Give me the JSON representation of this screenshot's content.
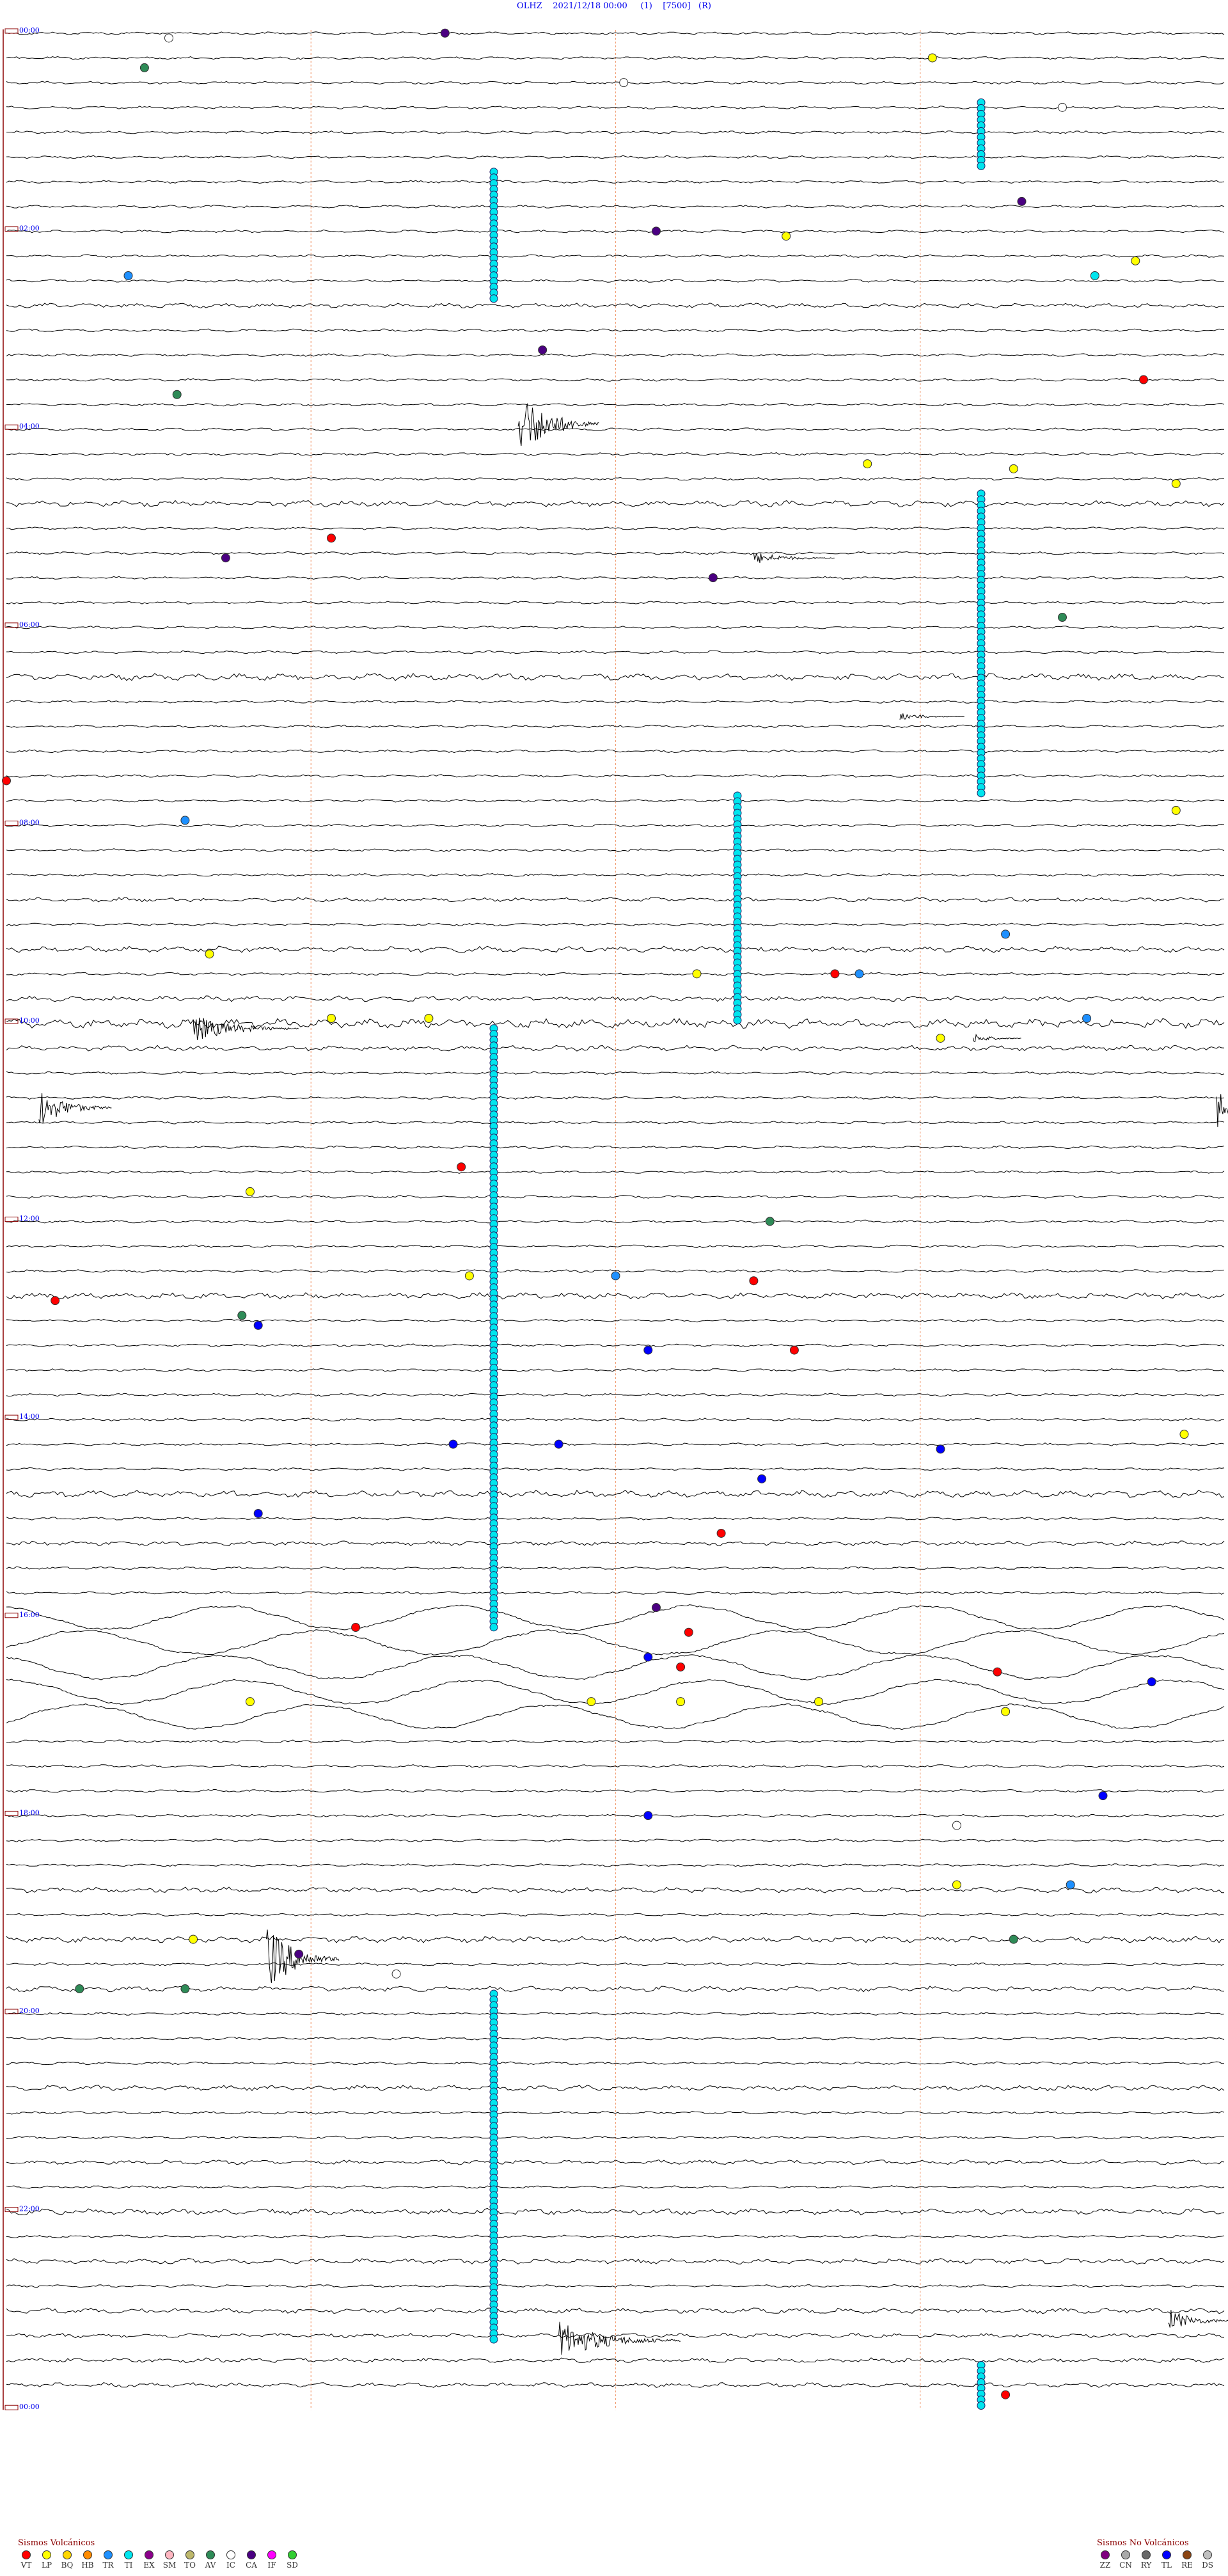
{
  "header": {
    "station": "OLHZ",
    "datetime": "2021/12/18 00:00",
    "count": "(1)",
    "scale": "[7500]",
    "flag": "(R)"
  },
  "colors": {
    "trace": "#000000",
    "time_label": "#0000ee",
    "minute_guides": "#f2a27a",
    "frame": "#8b0000"
  },
  "chart_data": {
    "type": "helicorder",
    "hour_labels": [
      "00:00",
      "02:00",
      "04:00",
      "06:00",
      "08:00",
      "10:00",
      "12:00",
      "14:00",
      "16:00",
      "18:00",
      "20:00",
      "22:00",
      "00:00"
    ],
    "lines_per_hour": 4,
    "minutes_per_line": 15,
    "total_hours": 24,
    "events": [
      {
        "hour": 0.05,
        "minute": 5.4,
        "type": "CA"
      },
      {
        "hour": 0.1,
        "minute": 2.0,
        "type": "IC"
      },
      {
        "hour": 0.3,
        "minute": 11.4,
        "type": "LP"
      },
      {
        "hour": 0.4,
        "minute": 1.7,
        "type": "AV"
      },
      {
        "hour": 0.55,
        "minute": 7.6,
        "type": "IC"
      },
      {
        "hour": 0.8,
        "minute": 13.0,
        "type": "IC"
      },
      {
        "hour": 1.75,
        "minute": 12.5,
        "type": "CA"
      },
      {
        "hour": 2.05,
        "minute": 8.0,
        "type": "CA"
      },
      {
        "hour": 2.1,
        "minute": 9.6,
        "type": "LP"
      },
      {
        "hour": 2.35,
        "minute": 13.9,
        "type": "LP"
      },
      {
        "hour": 2.5,
        "minute": 1.5,
        "type": "TR"
      },
      {
        "hour": 2.5,
        "minute": 13.4,
        "type": "TI"
      },
      {
        "hour": 3.25,
        "minute": 6.6,
        "type": "CA"
      },
      {
        "hour": 3.55,
        "minute": 14.0,
        "type": "VT"
      },
      {
        "hour": 3.7,
        "minute": 2.1,
        "type": "AV"
      },
      {
        "hour": 4.4,
        "minute": 10.6,
        "type": "LP"
      },
      {
        "hour": 4.45,
        "minute": 12.4,
        "type": "LP"
      },
      {
        "hour": 4.6,
        "minute": 14.4,
        "type": "LP"
      },
      {
        "hour": 5.15,
        "minute": 4.0,
        "type": "VT"
      },
      {
        "hour": 5.35,
        "minute": 2.7,
        "type": "CA"
      },
      {
        "hour": 5.55,
        "minute": 8.7,
        "type": "CA"
      },
      {
        "hour": 5.95,
        "minute": 13.0,
        "type": "AV"
      },
      {
        "hour": 7.6,
        "minute": 0.0,
        "type": "VT"
      },
      {
        "hour": 7.9,
        "minute": 14.4,
        "type": "LP"
      },
      {
        "hour": 8.0,
        "minute": 2.2,
        "type": "TR"
      },
      {
        "hour": 9.15,
        "minute": 12.3,
        "type": "TR"
      },
      {
        "hour": 9.35,
        "minute": 2.5,
        "type": "LP"
      },
      {
        "hour": 9.55,
        "minute": 8.5,
        "type": "LP"
      },
      {
        "hour": 9.55,
        "minute": 10.2,
        "type": "VT"
      },
      {
        "hour": 9.55,
        "minute": 10.5,
        "type": "TR"
      },
      {
        "hour": 10.0,
        "minute": 4.0,
        "type": "LP"
      },
      {
        "hour": 10.0,
        "minute": 5.2,
        "type": "LP"
      },
      {
        "hour": 10.0,
        "minute": 13.3,
        "type": "TR"
      },
      {
        "hour": 10.2,
        "minute": 11.5,
        "type": "LP"
      },
      {
        "hour": 11.5,
        "minute": 5.6,
        "type": "VT"
      },
      {
        "hour": 11.75,
        "minute": 3.0,
        "type": "LP"
      },
      {
        "hour": 12.05,
        "minute": 9.4,
        "type": "AV"
      },
      {
        "hour": 12.6,
        "minute": 5.7,
        "type": "LP"
      },
      {
        "hour": 12.6,
        "minute": 7.5,
        "type": "TR"
      },
      {
        "hour": 12.65,
        "minute": 9.2,
        "type": "VT"
      },
      {
        "hour": 12.85,
        "minute": 0.6,
        "type": "VT"
      },
      {
        "hour": 13.0,
        "minute": 2.9,
        "type": "AV"
      },
      {
        "hour": 13.1,
        "minute": 3.1,
        "type": "TL"
      },
      {
        "hour": 13.35,
        "minute": 7.9,
        "type": "TL"
      },
      {
        "hour": 13.35,
        "minute": 9.7,
        "type": "VT"
      },
      {
        "hour": 14.2,
        "minute": 14.5,
        "type": "LP"
      },
      {
        "hour": 14.3,
        "minute": 5.5,
        "type": "TL"
      },
      {
        "hour": 14.3,
        "minute": 6.8,
        "type": "TL"
      },
      {
        "hour": 14.35,
        "minute": 11.5,
        "type": "TL"
      },
      {
        "hour": 14.65,
        "minute": 9.3,
        "type": "TL"
      },
      {
        "hour": 15.0,
        "minute": 3.1,
        "type": "TL"
      },
      {
        "hour": 15.2,
        "minute": 8.8,
        "type": "VT"
      },
      {
        "hour": 15.95,
        "minute": 8.0,
        "type": "CA"
      },
      {
        "hour": 16.15,
        "minute": 4.3,
        "type": "VT"
      },
      {
        "hour": 16.2,
        "minute": 8.4,
        "type": "VT"
      },
      {
        "hour": 16.45,
        "minute": 7.9,
        "type": "TL"
      },
      {
        "hour": 16.55,
        "minute": 8.3,
        "type": "VT"
      },
      {
        "hour": 16.6,
        "minute": 12.2,
        "type": "VT"
      },
      {
        "hour": 16.7,
        "minute": 14.1,
        "type": "TL"
      },
      {
        "hour": 16.9,
        "minute": 3.0,
        "type": "LP"
      },
      {
        "hour": 16.9,
        "minute": 7.2,
        "type": "LP"
      },
      {
        "hour": 16.9,
        "minute": 8.3,
        "type": "LP"
      },
      {
        "hour": 16.9,
        "minute": 10.0,
        "type": "LP"
      },
      {
        "hour": 17.0,
        "minute": 12.3,
        "type": "LP"
      },
      {
        "hour": 17.85,
        "minute": 13.5,
        "type": "TL"
      },
      {
        "hour": 18.05,
        "minute": 7.9,
        "type": "TL"
      },
      {
        "hour": 18.15,
        "minute": 11.7,
        "type": "IC"
      },
      {
        "hour": 18.75,
        "minute": 11.7,
        "type": "LP"
      },
      {
        "hour": 18.75,
        "minute": 13.1,
        "type": "TR"
      },
      {
        "hour": 19.3,
        "minute": 2.3,
        "type": "LP"
      },
      {
        "hour": 19.3,
        "minute": 12.4,
        "type": "AV"
      },
      {
        "hour": 19.45,
        "minute": 3.6,
        "type": "CA"
      },
      {
        "hour": 19.65,
        "minute": 4.8,
        "type": "IC"
      },
      {
        "hour": 19.8,
        "minute": 0.9,
        "type": "AV"
      },
      {
        "hour": 19.8,
        "minute": 2.2,
        "type": "AV"
      },
      {
        "hour": 23.9,
        "minute": 12.3,
        "type": "VT"
      }
    ],
    "swarm_columns": [
      {
        "hour_start": 0.7,
        "hour_end": 1.35,
        "minute": 12.0
      },
      {
        "hour_start": 1.4,
        "hour_end": 2.7,
        "minute": 6.0
      },
      {
        "hour_start": 4.65,
        "hour_end": 7.7,
        "minute": 12.0
      },
      {
        "hour_start": 7.7,
        "hour_end": 10.0,
        "minute": 9.0
      },
      {
        "hour_start": 10.05,
        "hour_end": 16.1,
        "minute": 6.0
      },
      {
        "hour_start": 19.8,
        "hour_end": 23.3,
        "minute": 6.0
      },
      {
        "hour_start": 23.55,
        "hour_end": 24.0,
        "minute": 12.0
      }
    ],
    "bursts": [
      {
        "hour": 3.95,
        "minute": 6.3,
        "amp": 55,
        "dur": 1.0
      },
      {
        "hour": 5.3,
        "minute": 9.2,
        "amp": 10,
        "dur": 1.0
      },
      {
        "hour": 6.9,
        "minute": 11.0,
        "amp": 6,
        "dur": 0.8
      },
      {
        "hour": 10.05,
        "minute": 2.3,
        "amp": 22,
        "dur": 1.3
      },
      {
        "hour": 10.15,
        "minute": 11.9,
        "amp": 8,
        "dur": 0.6
      },
      {
        "hour": 10.85,
        "minute": 0.4,
        "amp": 30,
        "dur": 0.9
      },
      {
        "hour": 10.85,
        "minute": 14.9,
        "amp": 35,
        "dur": 0.3
      },
      {
        "hour": 19.45,
        "minute": 3.2,
        "amp": 55,
        "dur": 0.9
      },
      {
        "hour": 23.3,
        "minute": 6.8,
        "amp": 30,
        "dur": 1.5
      },
      {
        "hour": 23.1,
        "minute": 14.3,
        "amp": 20,
        "dur": 0.8
      }
    ],
    "noisy_lines": [
      {
        "line": 11,
        "amp": 3.0
      },
      {
        "line": 19,
        "amp": 4.0
      },
      {
        "line": 26,
        "amp": 4.5
      },
      {
        "line": 35,
        "amp": 3.0
      },
      {
        "line": 37,
        "amp": 4.0
      },
      {
        "line": 39,
        "amp": 3.5
      },
      {
        "line": 40,
        "amp": 6.0
      },
      {
        "line": 41,
        "amp": 3.5
      },
      {
        "line": 51,
        "amp": 4.0
      },
      {
        "line": 59,
        "amp": 4.5
      },
      {
        "line": 61,
        "amp": 3.0
      },
      {
        "line": 75,
        "amp": 3.5
      },
      {
        "line": 77,
        "amp": 4.0
      },
      {
        "line": 79,
        "amp": 3.5
      },
      {
        "line": 83,
        "amp": 3.5
      },
      {
        "line": 86,
        "amp": 3.0
      },
      {
        "line": 88,
        "amp": 4.0
      },
      {
        "line": 90,
        "amp": 3.5
      },
      {
        "line": 92,
        "amp": 3.5
      },
      {
        "line": 93,
        "amp": 3.0
      },
      {
        "line": 94,
        "amp": 3.0
      },
      {
        "line": 95,
        "amp": 3.0
      },
      {
        "line": 96,
        "amp": 5.0
      },
      {
        "line": 111,
        "amp": 4.0
      },
      {
        "line": 114,
        "amp": 4.0
      }
    ],
    "long_period_lines": [
      64,
      65,
      66,
      67,
      68
    ]
  },
  "legend": {
    "volcanic": {
      "title": "Sismos Volcánicos",
      "items": [
        {
          "code": "VT",
          "color": "#ff0000"
        },
        {
          "code": "LP",
          "color": "#ffff00"
        },
        {
          "code": "BQ",
          "color": "#ffd700"
        },
        {
          "code": "HB",
          "color": "#ff8c00"
        },
        {
          "code": "TR",
          "color": "#1e90ff"
        },
        {
          "code": "TI",
          "color": "#00e5ee"
        },
        {
          "code": "EX",
          "color": "#8b008b"
        },
        {
          "code": "SM",
          "color": "#ffb6c1"
        },
        {
          "code": "TO",
          "color": "#bdb76b"
        },
        {
          "code": "AV",
          "color": "#2e8b57"
        },
        {
          "code": "IC",
          "color": "#ffffff"
        },
        {
          "code": "CA",
          "color": "#4b0082"
        },
        {
          "code": "IF",
          "color": "#ff00ff"
        },
        {
          "code": "SD",
          "color": "#32cd32"
        }
      ]
    },
    "nonvolcanic": {
      "title": "Sismos No Volcánicos",
      "items": [
        {
          "code": "ZZ",
          "color": "#800080"
        },
        {
          "code": "CN",
          "color": "#a9a9a9"
        },
        {
          "code": "RY",
          "color": "#696969"
        },
        {
          "code": "TL",
          "color": "#0000ff"
        },
        {
          "code": "RE",
          "color": "#8b4513"
        },
        {
          "code": "DS",
          "color": "#c0c0c0"
        }
      ]
    }
  }
}
